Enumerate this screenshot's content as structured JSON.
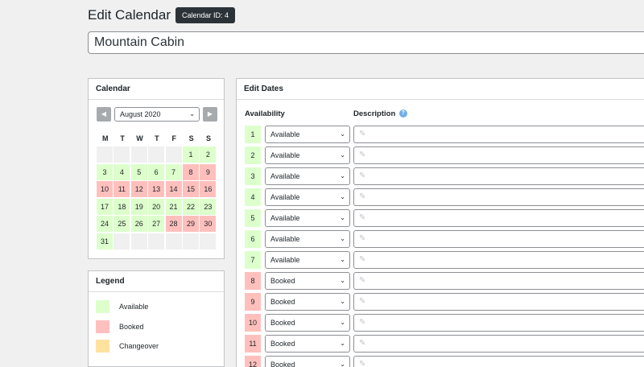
{
  "header": {
    "title": "Edit Calendar",
    "badge": "Calendar ID: 4",
    "calendar_name": "Mountain Cabin"
  },
  "calendar_box": {
    "title": "Calendar",
    "month": "August 2020",
    "weekdays": [
      "M",
      "T",
      "W",
      "T",
      "F",
      "S",
      "S"
    ],
    "leading_blanks": 5,
    "days": [
      {
        "d": "1",
        "s": "available"
      },
      {
        "d": "2",
        "s": "available"
      },
      {
        "d": "3",
        "s": "available"
      },
      {
        "d": "4",
        "s": "available"
      },
      {
        "d": "5",
        "s": "available"
      },
      {
        "d": "6",
        "s": "available"
      },
      {
        "d": "7",
        "s": "available"
      },
      {
        "d": "8",
        "s": "booked"
      },
      {
        "d": "9",
        "s": "booked"
      },
      {
        "d": "10",
        "s": "booked"
      },
      {
        "d": "11",
        "s": "booked"
      },
      {
        "d": "12",
        "s": "booked"
      },
      {
        "d": "13",
        "s": "booked"
      },
      {
        "d": "14",
        "s": "booked"
      },
      {
        "d": "15",
        "s": "booked"
      },
      {
        "d": "16",
        "s": "booked"
      },
      {
        "d": "17",
        "s": "available"
      },
      {
        "d": "18",
        "s": "available"
      },
      {
        "d": "19",
        "s": "available"
      },
      {
        "d": "20",
        "s": "available"
      },
      {
        "d": "21",
        "s": "available"
      },
      {
        "d": "22",
        "s": "available"
      },
      {
        "d": "23",
        "s": "available"
      },
      {
        "d": "24",
        "s": "available"
      },
      {
        "d": "25",
        "s": "available"
      },
      {
        "d": "26",
        "s": "available"
      },
      {
        "d": "27",
        "s": "available"
      },
      {
        "d": "28",
        "s": "booked"
      },
      {
        "d": "29",
        "s": "booked"
      },
      {
        "d": "30",
        "s": "booked"
      },
      {
        "d": "31",
        "s": "available"
      }
    ],
    "trailing_blanks": 6
  },
  "legend": {
    "title": "Legend",
    "items": [
      {
        "label": "Available",
        "color": "#ddffcc"
      },
      {
        "label": "Booked",
        "color": "#ffc0bd"
      },
      {
        "label": "Changeover",
        "color": "#ffe1a0"
      }
    ]
  },
  "edit_dates": {
    "title": "Edit Dates",
    "col_availability": "Availability",
    "col_description": "Description",
    "help_glyph": "?",
    "rows": [
      {
        "day": "1",
        "status": "available",
        "value": "Available"
      },
      {
        "day": "2",
        "status": "available",
        "value": "Available"
      },
      {
        "day": "3",
        "status": "available",
        "value": "Available"
      },
      {
        "day": "4",
        "status": "available",
        "value": "Available"
      },
      {
        "day": "5",
        "status": "available",
        "value": "Available"
      },
      {
        "day": "6",
        "status": "available",
        "value": "Available"
      },
      {
        "day": "7",
        "status": "available",
        "value": "Available"
      },
      {
        "day": "8",
        "status": "booked",
        "value": "Booked"
      },
      {
        "day": "9",
        "status": "booked",
        "value": "Booked"
      },
      {
        "day": "10",
        "status": "booked",
        "value": "Booked"
      },
      {
        "day": "11",
        "status": "booked",
        "value": "Booked"
      },
      {
        "day": "12",
        "status": "booked",
        "value": "Booked"
      }
    ]
  },
  "icons": {
    "prev": "prev-arrow-icon",
    "next": "next-arrow-icon",
    "chevron": "chevron-down-icon",
    "pencil": "pencil-icon",
    "help": "help-icon"
  }
}
